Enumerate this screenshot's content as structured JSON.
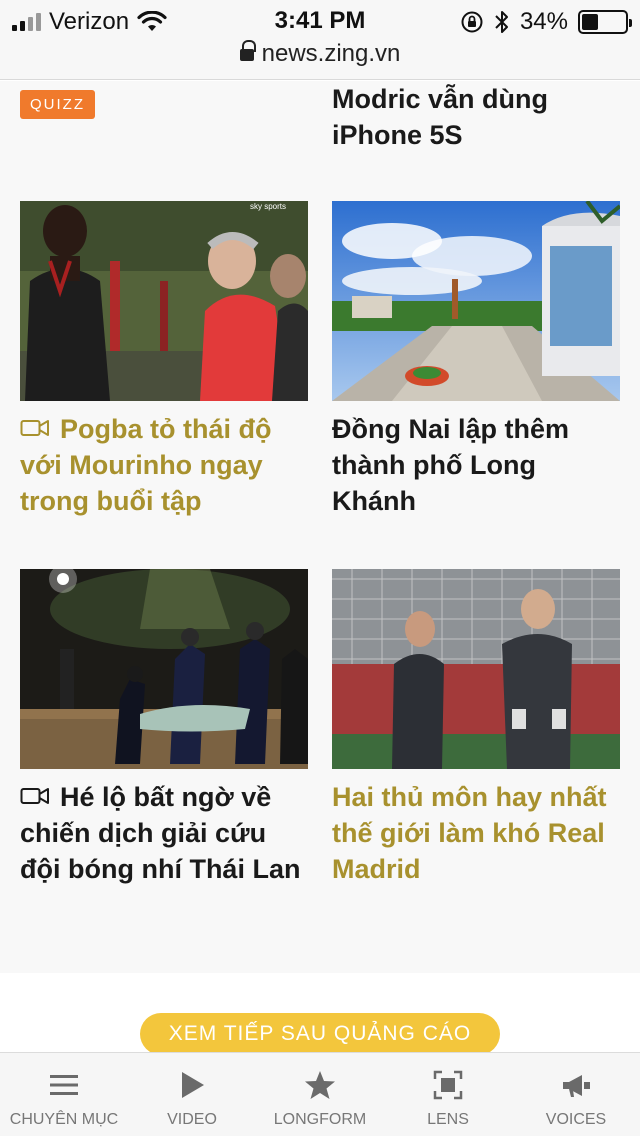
{
  "status_bar": {
    "carrier": "Verizon",
    "time": "3:41 PM",
    "battery": "34%",
    "battery_level": 0.34,
    "url": "news.zing.vn"
  },
  "top": {
    "badge": "QUIZZ",
    "title": "Modric vẫn dùng iPhone 5S"
  },
  "articles": [
    {
      "title": "Pogba tỏ thái độ với Mourinho ngay trong buổi tập",
      "video": true,
      "color": "#a8912e",
      "watermark": "sky sports"
    },
    {
      "title": "Đồng Nai lập thêm thành phố Long Khánh",
      "video": false,
      "color": "#1a1a1a"
    },
    {
      "title": "Hé lộ bất ngờ về chiến dịch giải cứu đội bóng nhí Thái Lan",
      "video": true,
      "color": "#1a1a1a"
    },
    {
      "title": "Hai thủ môn hay nhất thế giới làm khó Real Madrid",
      "video": false,
      "color": "#a8912e"
    }
  ],
  "load_more": "XEM TIẾP SAU QUẢNG CÁO",
  "nav": [
    {
      "label": "CHUYÊN MỤC",
      "icon": "menu-icon"
    },
    {
      "label": "VIDEO",
      "icon": "play-icon"
    },
    {
      "label": "LONGFORM",
      "icon": "star-icon"
    },
    {
      "label": "LENS",
      "icon": "lens-icon"
    },
    {
      "label": "VOICES",
      "icon": "megaphone-icon"
    }
  ],
  "colors": {
    "accent_gold": "#a8912e",
    "quizz_orange": "#f07a2c",
    "button_yellow": "#f3c63c"
  }
}
